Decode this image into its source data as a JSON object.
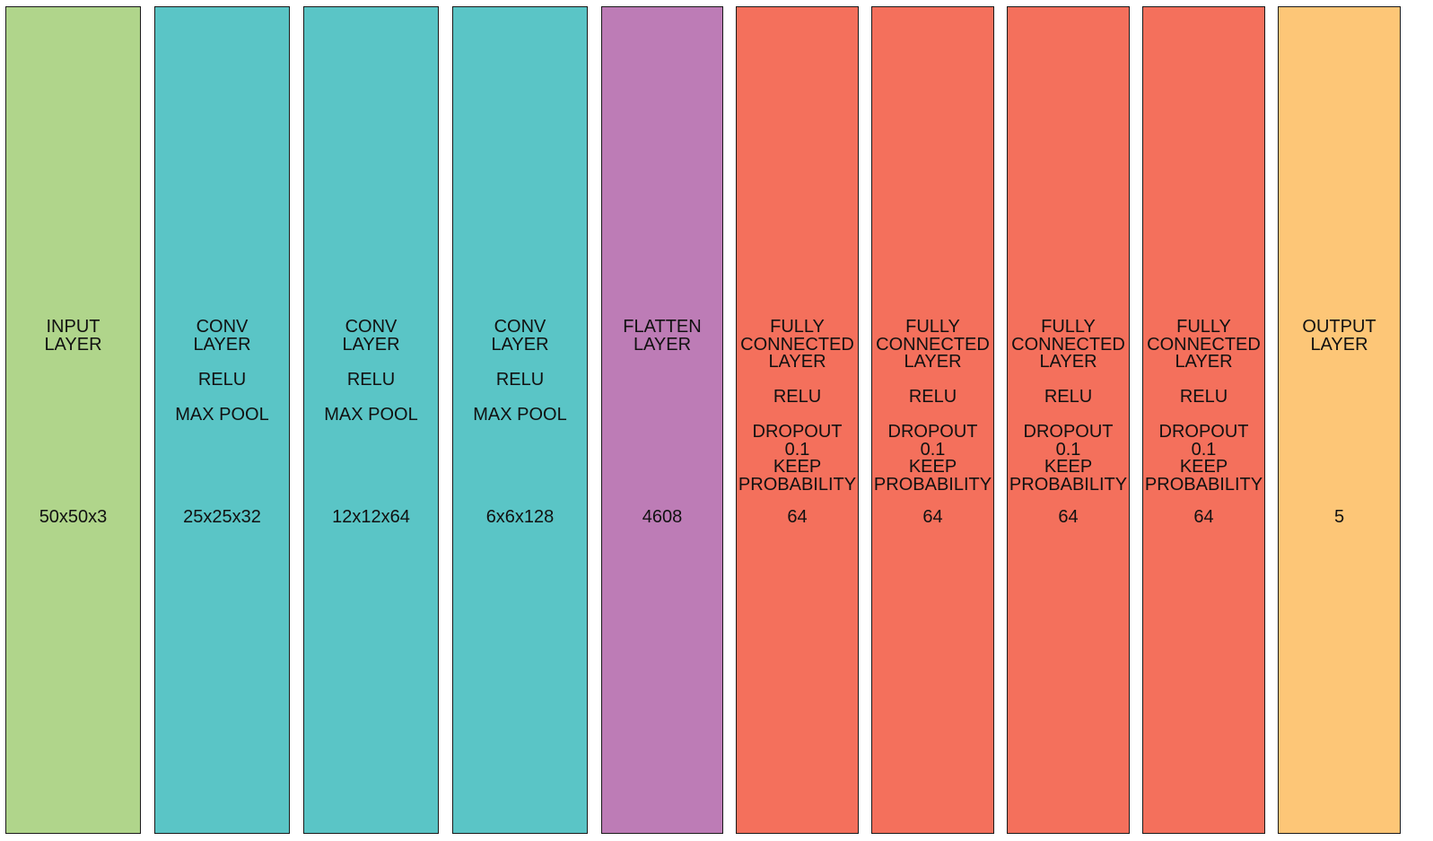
{
  "colors": {
    "input": "#b0d58b",
    "conv": "#5ac5c6",
    "flatten": "#bd7cb6",
    "fc": "#f4705c",
    "output": "#fdc677"
  },
  "layers": [
    {
      "kind": "input",
      "lines": [
        "INPUT",
        "LAYER"
      ],
      "size": "50x50x3"
    },
    {
      "kind": "conv",
      "lines": [
        "CONV",
        "LAYER",
        "",
        "RELU",
        "",
        "MAX POOL"
      ],
      "size": "25x25x32"
    },
    {
      "kind": "conv",
      "lines": [
        "CONV",
        "LAYER",
        "",
        "RELU",
        "",
        "MAX POOL"
      ],
      "size": "12x12x64"
    },
    {
      "kind": "conv",
      "lines": [
        "CONV",
        "LAYER",
        "",
        "RELU",
        "",
        "MAX POOL"
      ],
      "size": "6x6x128"
    },
    {
      "kind": "flatten",
      "lines": [
        "FLATTEN",
        "LAYER"
      ],
      "size": "4608"
    },
    {
      "kind": "fc",
      "lines": [
        "FULLY",
        "CONNECTED",
        "LAYER",
        "",
        "RELU",
        "",
        "DROPOUT",
        "0.1",
        "KEEP",
        "PROBABILITY"
      ],
      "size": "64"
    },
    {
      "kind": "fc",
      "lines": [
        "FULLY",
        "CONNECTED",
        "LAYER",
        "",
        "RELU",
        "",
        "DROPOUT",
        "0.1",
        "KEEP",
        "PROBABILITY"
      ],
      "size": "64"
    },
    {
      "kind": "fc",
      "lines": [
        "FULLY",
        "CONNECTED",
        "LAYER",
        "",
        "RELU",
        "",
        "DROPOUT",
        "0.1",
        "KEEP",
        "PROBABILITY"
      ],
      "size": "64"
    },
    {
      "kind": "fc",
      "lines": [
        "FULLY",
        "CONNECTED",
        "LAYER",
        "",
        "RELU",
        "",
        "DROPOUT",
        "0.1",
        "KEEP",
        "PROBABILITY"
      ],
      "size": "64"
    },
    {
      "kind": "output",
      "lines": [
        "OUTPUT",
        "LAYER"
      ],
      "size": "5"
    }
  ]
}
